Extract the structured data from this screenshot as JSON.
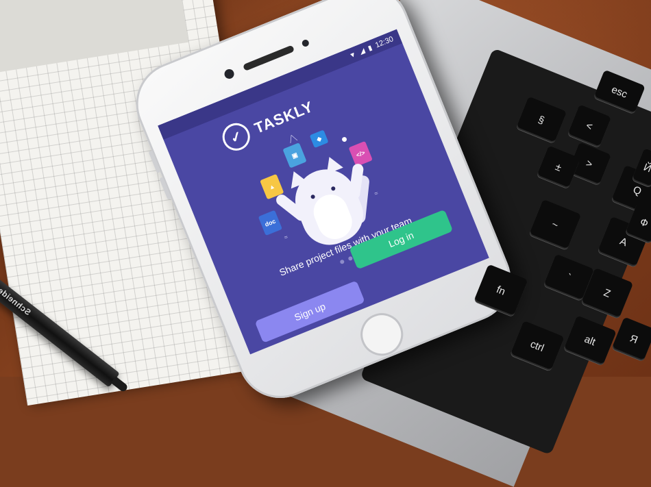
{
  "status_bar": {
    "time": "12:30",
    "wifi_icon": "wifi-icon",
    "signal_icon": "signal-icon",
    "battery_icon": "battery-icon"
  },
  "app": {
    "name": "TASKLY",
    "logo_icon": "check-chat-bubble-icon",
    "tagline": "Share project files with your team",
    "carousel": {
      "count": 3,
      "active_index": 2
    },
    "buttons": {
      "signup_label": "Sign up",
      "login_label": "Log in"
    },
    "colors": {
      "background": "#4a47a3",
      "signup": "#8b87f0",
      "login": "#2fc48b"
    }
  },
  "illustration": {
    "file_icons": [
      {
        "name": "google-drive-icon",
        "color": "#f7c744"
      },
      {
        "name": "image-file-icon",
        "color": "#4aa3df"
      },
      {
        "name": "dropbox-icon",
        "color": "#2d8ce3"
      },
      {
        "name": "github-icon",
        "color": "#ffffff"
      },
      {
        "name": "code-file-icon",
        "color": "#d94fb3",
        "text": "</>"
      },
      {
        "name": "doc-file-icon",
        "color": "#3b6fd8",
        "text": "doc"
      }
    ]
  },
  "scene": {
    "pen_text": "Schneider",
    "keyboard_keys": [
      "esc",
      "fn",
      "ctrl",
      "alt",
      "Q",
      "A",
      "Z",
      "Ф",
      "Й",
      "Я",
      "~",
      "`",
      "<",
      ">",
      "±",
      "§"
    ]
  }
}
